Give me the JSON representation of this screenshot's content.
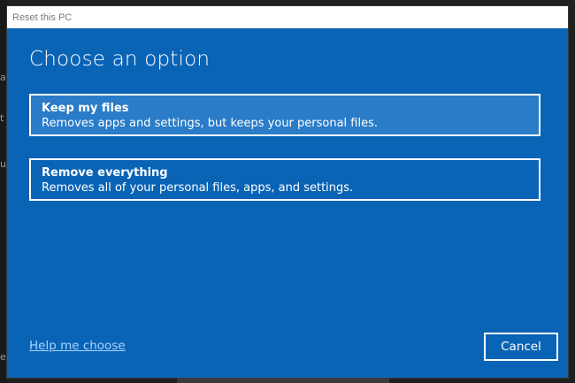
{
  "window": {
    "title": "Reset this PC"
  },
  "dialog": {
    "heading": "Choose an option",
    "options": [
      {
        "title": "Keep my files",
        "description": "Removes apps and settings, but keeps your personal files.",
        "highlighted": true
      },
      {
        "title": "Remove everything",
        "description": "Removes all of your personal files, apps, and settings.",
        "highlighted": false
      }
    ],
    "help_link": "Help me choose",
    "cancel_label": "Cancel"
  },
  "background_fragments": [
    "a",
    "t",
    "u",
    "e"
  ],
  "colors": {
    "dialog_background": "#0a64b6",
    "highlighted_option": "#2a7cc8",
    "link": "#a8d4ff",
    "text": "#ffffff"
  }
}
